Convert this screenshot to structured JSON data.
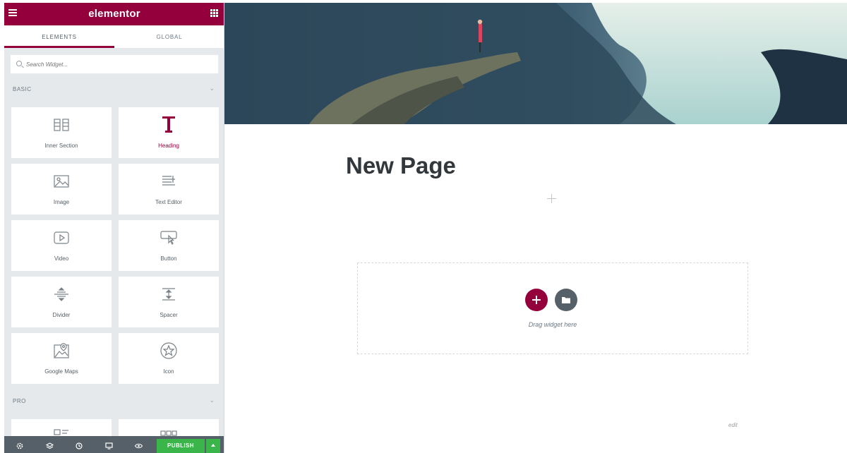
{
  "app": {
    "logo": "elementor",
    "tabs": [
      {
        "label": "ELEMENTS",
        "active": true
      },
      {
        "label": "GLOBAL",
        "active": false
      }
    ],
    "search": {
      "placeholder": "Search Widget..."
    }
  },
  "categories": {
    "basic": "BASIC",
    "pro": "PRO"
  },
  "widgets": [
    {
      "label": "Inner Section",
      "icon": "columns-icon"
    },
    {
      "label": "Heading",
      "icon": "heading-icon",
      "highlight": true
    },
    {
      "label": "Image",
      "icon": "image-icon"
    },
    {
      "label": "Text Editor",
      "icon": "text-editor-icon"
    },
    {
      "label": "Video",
      "icon": "video-icon"
    },
    {
      "label": "Button",
      "icon": "button-icon"
    },
    {
      "label": "Divider",
      "icon": "divider-icon"
    },
    {
      "label": "Spacer",
      "icon": "spacer-icon"
    },
    {
      "label": "Google Maps",
      "icon": "map-icon"
    },
    {
      "label": "Icon",
      "icon": "star-icon"
    }
  ],
  "footer": {
    "publish_label": "PUBLISH"
  },
  "preview": {
    "page_title": "New Page",
    "drag_text": "Drag widget here",
    "edit_link": "edit"
  },
  "colors": {
    "brand": "#93003c",
    "publish": "#39b54a",
    "panel": "#e6e9ec",
    "footer": "#556068"
  }
}
